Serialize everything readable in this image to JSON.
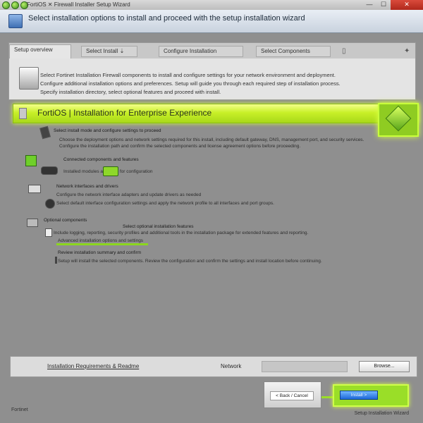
{
  "window": {
    "title": "FortiOS ✕ Firewall Installer Setup Wizard",
    "controls": {
      "minimize": "—",
      "maximize": "☐",
      "close": "✕"
    }
  },
  "header": {
    "text": "Select installation options to install and proceed with the setup installation wizard"
  },
  "tabs": [
    {
      "label": "Setup overview"
    },
    {
      "label": "Select Install ⇣"
    },
    {
      "label": "Configure Installation"
    },
    {
      "label": "Select Components"
    }
  ],
  "panel": {
    "text": [
      "Select Fortinet Installation Firewall components to install and configure settings for your network environment and deployment.",
      "Configure additional installation options and preferences. Setup will guide you through each required step of installation process.",
      "Specify installation directory, select optional features and proceed with install."
    ]
  },
  "banner": {
    "title": "FortiOS | Installation for Enterprise Experience"
  },
  "list": {
    "item1": {
      "head": "Select install mode and configure settings to proceed",
      "sub": [
        "Choose the deployment options and network settings required for this install, including default gateway, DNS, management port, and security services.",
        "Configure the installation path and confirm the selected components and license agreement options before proceeding."
      ]
    },
    "item2": {
      "head": "Connected components and features",
      "sub": "Installed modules available for configuration"
    },
    "item3": {
      "head": "Network interfaces and drivers",
      "sub": [
        "Configure the network interface adapters and update drivers as needed",
        "Select default interface configuration settings and apply the network profile to all interfaces and port groups."
      ]
    },
    "item4": {
      "head": "Optional components",
      "sub_head": "Select optional installation features",
      "sub": "Include logging, reporting, security profiles and additional tools in the installation package for extended features and reporting.",
      "link": "Advanced installation options and settings"
    },
    "item5": {
      "head": "Review installation summary and confirm",
      "sub": "Setup will install the selected components. Review the configuration and confirm the settings and install location before continuing."
    }
  },
  "bottom": {
    "link": "Installation Requirements & Readme",
    "label": "Network",
    "button": "Browse..."
  },
  "buttons": {
    "back": "< Back / Cancel",
    "next": "Install >"
  },
  "footer": {
    "left": "Fortinet",
    "right": "Setup Installation Wizard"
  },
  "colors": {
    "accent": "#a8d81a",
    "titlebar_close": "#c9382b",
    "header_bg": "#dce3ec",
    "background": "#8f8f8f"
  }
}
